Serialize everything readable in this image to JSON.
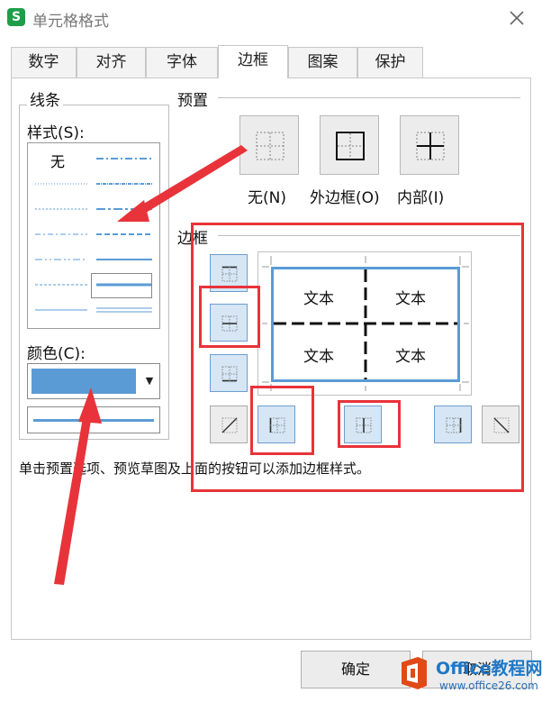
{
  "window": {
    "title": "单元格格式",
    "app_icon": "S"
  },
  "tabs": [
    {
      "label": "数字"
    },
    {
      "label": "对齐"
    },
    {
      "label": "字体"
    },
    {
      "label": "边框",
      "active": true
    },
    {
      "label": "图案"
    },
    {
      "label": "保护"
    }
  ],
  "line_group": {
    "label": "线条",
    "style_label": "样式(S):",
    "style_none": "无",
    "color_label": "颜色(C):",
    "color_value": "#5b9bd5"
  },
  "presets": {
    "label": "预置",
    "items": [
      {
        "label": "无(N)",
        "icon": "preset-none-icon"
      },
      {
        "label": "外边框(O)",
        "icon": "preset-outline-icon"
      },
      {
        "label": "内部(I)",
        "icon": "preset-inside-icon"
      }
    ]
  },
  "border": {
    "label": "边框",
    "preview_cells": [
      "文本",
      "文本",
      "文本",
      "文本"
    ]
  },
  "hint": "单击预置选项、预览草图及上面的按钮可以添加边框样式。",
  "buttons": {
    "ok": "确定",
    "cancel": "取消"
  },
  "watermark": {
    "title": "Office教程网",
    "url": "www.office26.com"
  },
  "colors": {
    "accent": "#5b9bd5",
    "highlight": "#e8333a",
    "brand": "#1f9e4a"
  }
}
